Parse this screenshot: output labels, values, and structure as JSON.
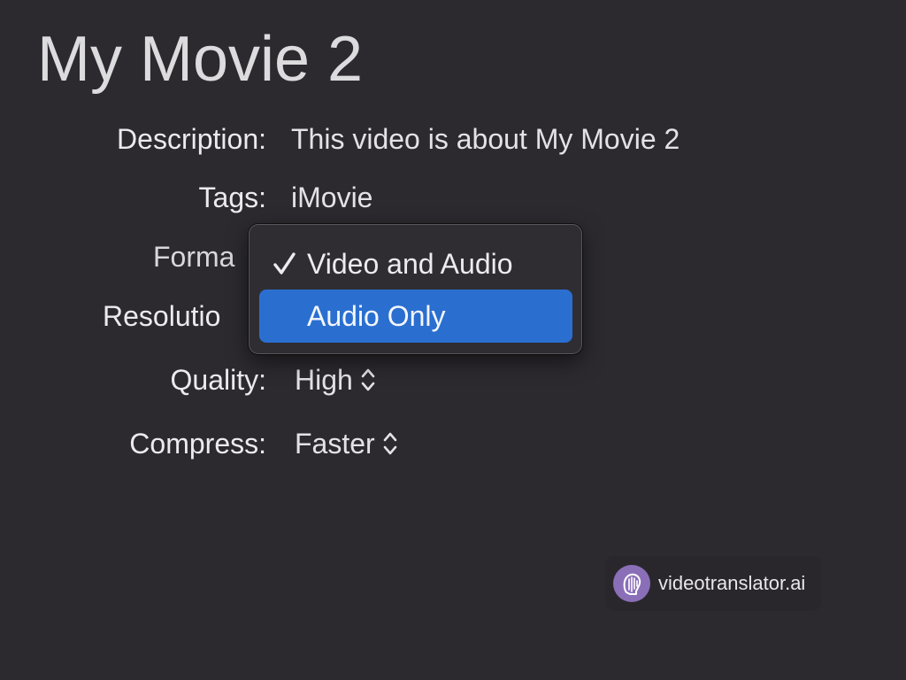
{
  "header": {
    "title": "My Movie 2"
  },
  "form": {
    "description_label": "Description:",
    "description_value": "This video is about My Movie 2",
    "tags_label": "Tags:",
    "tags_value": "iMovie",
    "format_label": "Forma",
    "resolution_label": "Resolutio",
    "quality_label": "Quality:",
    "quality_value": "High",
    "compress_label": "Compress:",
    "compress_value": "Faster"
  },
  "format_menu": {
    "items": [
      {
        "label": "Video and Audio",
        "checked": true,
        "highlighted": false
      },
      {
        "label": "Audio Only",
        "checked": false,
        "highlighted": true
      }
    ],
    "check_icon": "checkmark-icon"
  },
  "watermark": {
    "text": "videotranslator.ai",
    "icon": "videotranslator-logo-icon"
  },
  "colors": {
    "background": "#2c2a2f",
    "menu_highlight": "#2a6fd0",
    "logo_purple": "#8a6fb8"
  }
}
